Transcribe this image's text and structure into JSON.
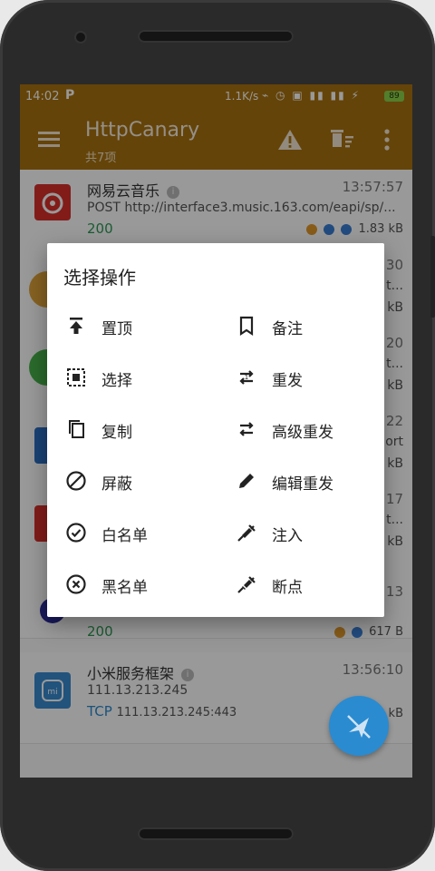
{
  "status_bar": {
    "time": "14:02",
    "speed": "1.1K/s",
    "battery": "89"
  },
  "app_bar": {
    "title": "HttpCanary",
    "subtitle": "共7项"
  },
  "list": [
    {
      "title": "网易云音乐",
      "time": "13:57:57",
      "url": "POST http://interface3.music.163.com/eapi/sp/...",
      "status": "200",
      "size": "1.83 kB",
      "color": "#d9302a"
    }
  ],
  "peek_rows": [
    {
      "time": "30",
      "text": "t...",
      "size": "kB"
    },
    {
      "time": "20",
      "text": "t...",
      "size": "kB"
    },
    {
      "time": "22",
      "text": "ort",
      "size": "kB"
    },
    {
      "time": "17",
      "text": "t...",
      "size": "kB"
    },
    {
      "time": "13",
      "text": "",
      "size": ""
    }
  ],
  "list_bottom": [
    {
      "status": "200",
      "size": "617 B"
    },
    {
      "title": "小米服务框架",
      "time": "13:56:10",
      "url": "111.13.213.245",
      "status": "TCP",
      "extra": "111.13.213.245:443",
      "size": "kB"
    }
  ],
  "dialog": {
    "title": "选择操作",
    "actions": [
      {
        "label": "置顶",
        "icon": "pin-top-icon"
      },
      {
        "label": "备注",
        "icon": "bookmark-icon"
      },
      {
        "label": "选择",
        "icon": "select-icon"
      },
      {
        "label": "重发",
        "icon": "resend-icon"
      },
      {
        "label": "复制",
        "icon": "copy-icon"
      },
      {
        "label": "高级重发",
        "icon": "advanced-resend-icon"
      },
      {
        "label": "屏蔽",
        "icon": "block-icon"
      },
      {
        "label": "编辑重发",
        "icon": "edit-icon"
      },
      {
        "label": "白名单",
        "icon": "whitelist-icon"
      },
      {
        "label": "注入",
        "icon": "inject-icon"
      },
      {
        "label": "黑名单",
        "icon": "blacklist-icon"
      },
      {
        "label": "断点",
        "icon": "breakpoint-icon"
      }
    ]
  },
  "colors": {
    "accent": "#a8720f",
    "fab": "#2a8bd0",
    "status_ok": "#2e9a55"
  }
}
